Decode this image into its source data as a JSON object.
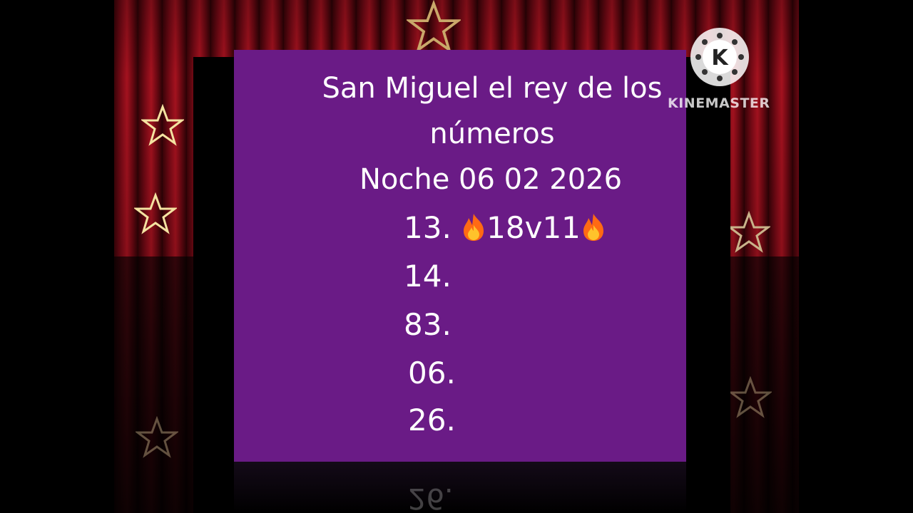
{
  "title_line1": "San Miguel el rey de los",
  "title_line2": "números",
  "subtitle": "Noche 06 02 2026",
  "numbers": [
    {
      "label": "13.",
      "extra": "18v11"
    },
    {
      "label": "14."
    },
    {
      "label": "83."
    },
    {
      "label": "06."
    },
    {
      "label": "26."
    }
  ],
  "reflection_text": "26.",
  "watermark": {
    "brand": "KINEMASTER",
    "logo_letter": "K"
  },
  "icons": [
    "flame-icon",
    "star-icon",
    "kinemaster-logo-icon"
  ],
  "colors": {
    "panel": "#6a1b86",
    "curtain": "#a5121f",
    "star": "#f4e3a1"
  }
}
